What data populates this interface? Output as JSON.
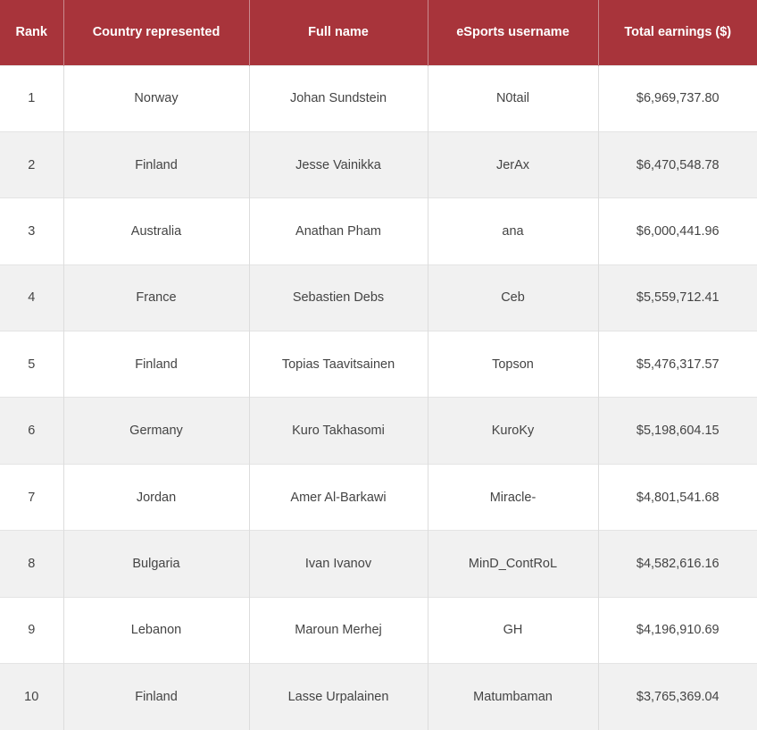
{
  "colors": {
    "header_bg": "#a8343b",
    "header_text": "#ffffff",
    "row_alt_bg": "#f1f1f1",
    "cell_text": "#444444"
  },
  "table": {
    "headers": [
      "Rank",
      "Country represented",
      "Full name",
      "eSports username",
      "Total earnings ($)"
    ],
    "rows": [
      [
        "1",
        "Norway",
        "Johan Sundstein",
        "N0tail",
        "$6,969,737.80"
      ],
      [
        "2",
        "Finland",
        "Jesse Vainikka",
        "JerAx",
        "$6,470,548.78"
      ],
      [
        "3",
        "Australia",
        "Anathan Pham",
        "ana",
        "$6,000,441.96"
      ],
      [
        "4",
        "France",
        "Sebastien Debs",
        "Ceb",
        "$5,559,712.41"
      ],
      [
        "5",
        "Finland",
        "Topias Taavitsainen",
        "Topson",
        "$5,476,317.57"
      ],
      [
        "6",
        "Germany",
        "Kuro Takhasomi",
        "KuroKy",
        "$5,198,604.15"
      ],
      [
        "7",
        "Jordan",
        "Amer Al-Barkawi",
        "Miracle-",
        "$4,801,541.68"
      ],
      [
        "8",
        "Bulgaria",
        "Ivan Ivanov",
        "MinD_ContRoL",
        "$4,582,616.16"
      ],
      [
        "9",
        "Lebanon",
        "Maroun Merhej",
        "GH",
        "$4,196,910.69"
      ],
      [
        "10",
        "Finland",
        "Lasse Urpalainen",
        "Matumbaman",
        "$3,765,369.04"
      ]
    ]
  }
}
